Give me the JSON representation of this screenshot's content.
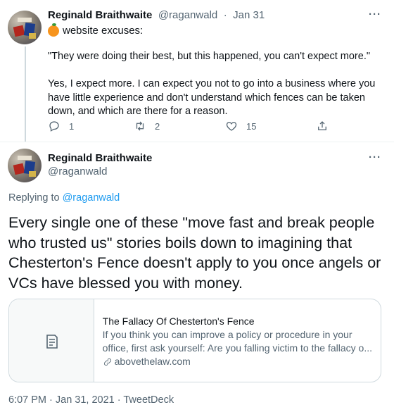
{
  "tweet1": {
    "author_name": "Reginald Braithwaite",
    "author_handle": "@raganwald",
    "separator": "·",
    "date": "Jan 31",
    "more": "···",
    "subtitle": "website excuses:",
    "paragraphs": [
      "\"They were doing their best, but this happened, you can't expect more.\"",
      "Yes, I expect more. I can expect you not to go into a business where you have little experience and don't understand which fences can be taken down, and which are there for a reason."
    ],
    "actions": {
      "reply_count": "1",
      "retweet_count": "2",
      "like_count": "15"
    }
  },
  "tweet2": {
    "author_name": "Reginald Braithwaite",
    "author_handle": "@raganwald",
    "more": "···",
    "replying_prefix": "Replying to",
    "replying_to": "@raganwald",
    "text": "Every single one of these \"move fast and break people who trusted us\" stories boils down to imagining that Chesterton's Fence doesn't apply to you once angels or VCs have blessed you with money.",
    "card": {
      "title": "The Fallacy Of Chesterton's Fence",
      "desc_line1": "If you think you can improve a policy or procedure in your",
      "desc_line2": "office, first ask yourself: Are you falling victim to the fallacy o...",
      "domain": "abovethelaw.com"
    },
    "timestamp": "6:07 PM · Jan 31, 2021 · TweetDeck"
  },
  "colors": {
    "text": "#0f1419",
    "muted": "#536471",
    "link": "#1d9bf0",
    "border": "#cfd9de"
  },
  "icons": [
    "reply-icon",
    "retweet-icon",
    "like-icon",
    "share-icon",
    "article-icon",
    "link-icon",
    "orange-emoji-icon",
    "more-icon"
  ]
}
